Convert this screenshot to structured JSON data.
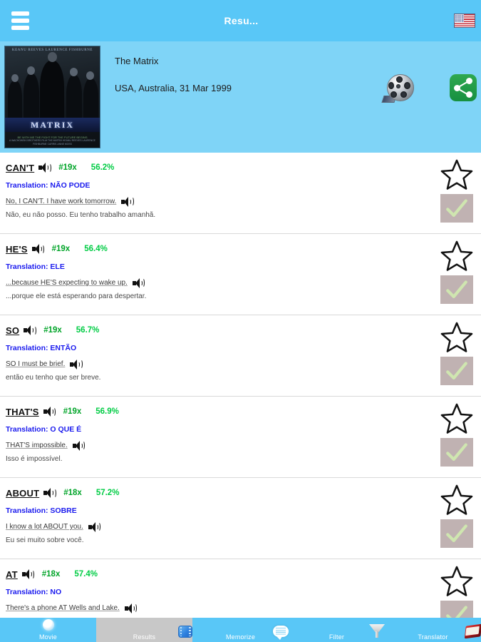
{
  "header": {
    "menu_icon": "hamburger-icon",
    "title": "Resu...",
    "flag_icon": "us-flag-icon"
  },
  "movie": {
    "poster_title": "MATRIX",
    "poster_cast": "KEANU REEVES     LAURENCE FISHBURNE",
    "poster_credits": "A WACHOWSKI BROTHERS FILM  THE MATRIX  KEANU REEVES LAURENCE FISHBURNE CARRIE-ANNE MOSS",
    "poster_tagline": "BE WITH ME THE FIGHT FOR THE FUTURE BEGINS",
    "title": "The Matrix",
    "subtitle": "USA, Australia, 31 Mar 1999",
    "reel_icon": "film-reel-icon",
    "share_icon": "share-icon"
  },
  "rows": [
    {
      "word": "CAN'T",
      "count": "#19x",
      "pct": "56.2%",
      "translation": "Translation: NÃO PODE",
      "example_en": "No, I CAN'T. I have work tomorrow.",
      "example_pt": "Não, eu não posso. Eu tenho trabalho amanhã.",
      "star_icon": "star-outline-icon",
      "check_icon": "check-icon"
    },
    {
      "word": "HE'S",
      "count": "#19x",
      "pct": "56.4%",
      "translation": "Translation: ELE",
      "example_en": "...because HE'S expecting to wake up.",
      "example_pt": "...porque ele está esperando para despertar.",
      "star_icon": "star-outline-icon",
      "check_icon": "check-icon"
    },
    {
      "word": "SO",
      "count": "#19x",
      "pct": "56.7%",
      "translation": "Translation: ENTÃO",
      "example_en": "SO I must be brief.",
      "example_pt": "então eu tenho que ser breve.",
      "star_icon": "star-outline-icon",
      "check_icon": "check-icon"
    },
    {
      "word": "THAT'S",
      "count": "#19x",
      "pct": "56.9%",
      "translation": "Translation: O QUE É",
      "example_en": "THAT'S impossible.",
      "example_pt": "Isso é impossível.",
      "star_icon": "star-outline-icon",
      "check_icon": "check-icon"
    },
    {
      "word": "ABOUT",
      "count": "#18x",
      "pct": "57.2%",
      "translation": "Translation: SOBRE",
      "example_en": "I know a lot ABOUT you.",
      "example_pt": "Eu sei muito sobre você.",
      "star_icon": "star-outline-icon",
      "check_icon": "check-icon"
    },
    {
      "word": "AT",
      "count": "#18x",
      "pct": "57.4%",
      "translation": "Translation: NO",
      "example_en": "There's a phone AT Wells and Lake.",
      "example_pt": "",
      "star_icon": "star-outline-icon",
      "check_icon": "check-icon"
    }
  ],
  "nav": {
    "items": [
      {
        "label": "Movie",
        "icon": "movie-icon",
        "active": false
      },
      {
        "label": "Results",
        "icon": "results-icon",
        "active": true
      },
      {
        "label": "Memorize",
        "icon": "memorize-icon",
        "active": false
      },
      {
        "label": "Filter",
        "icon": "filter-icon",
        "active": false
      },
      {
        "label": "Translator",
        "icon": "translator-icon",
        "active": false
      }
    ]
  },
  "colors": {
    "header_bg": "#59c7f7",
    "movie_panel_bg": "#7fd4f7",
    "count_green": "#00a428",
    "pct_green": "#00cc44",
    "translation_blue": "#1a1aee",
    "check_bg": "#c0b2b2",
    "check_green": "#cfe6b0",
    "share_green": "#179040",
    "nav_active_bg": "#c8c8c8"
  }
}
